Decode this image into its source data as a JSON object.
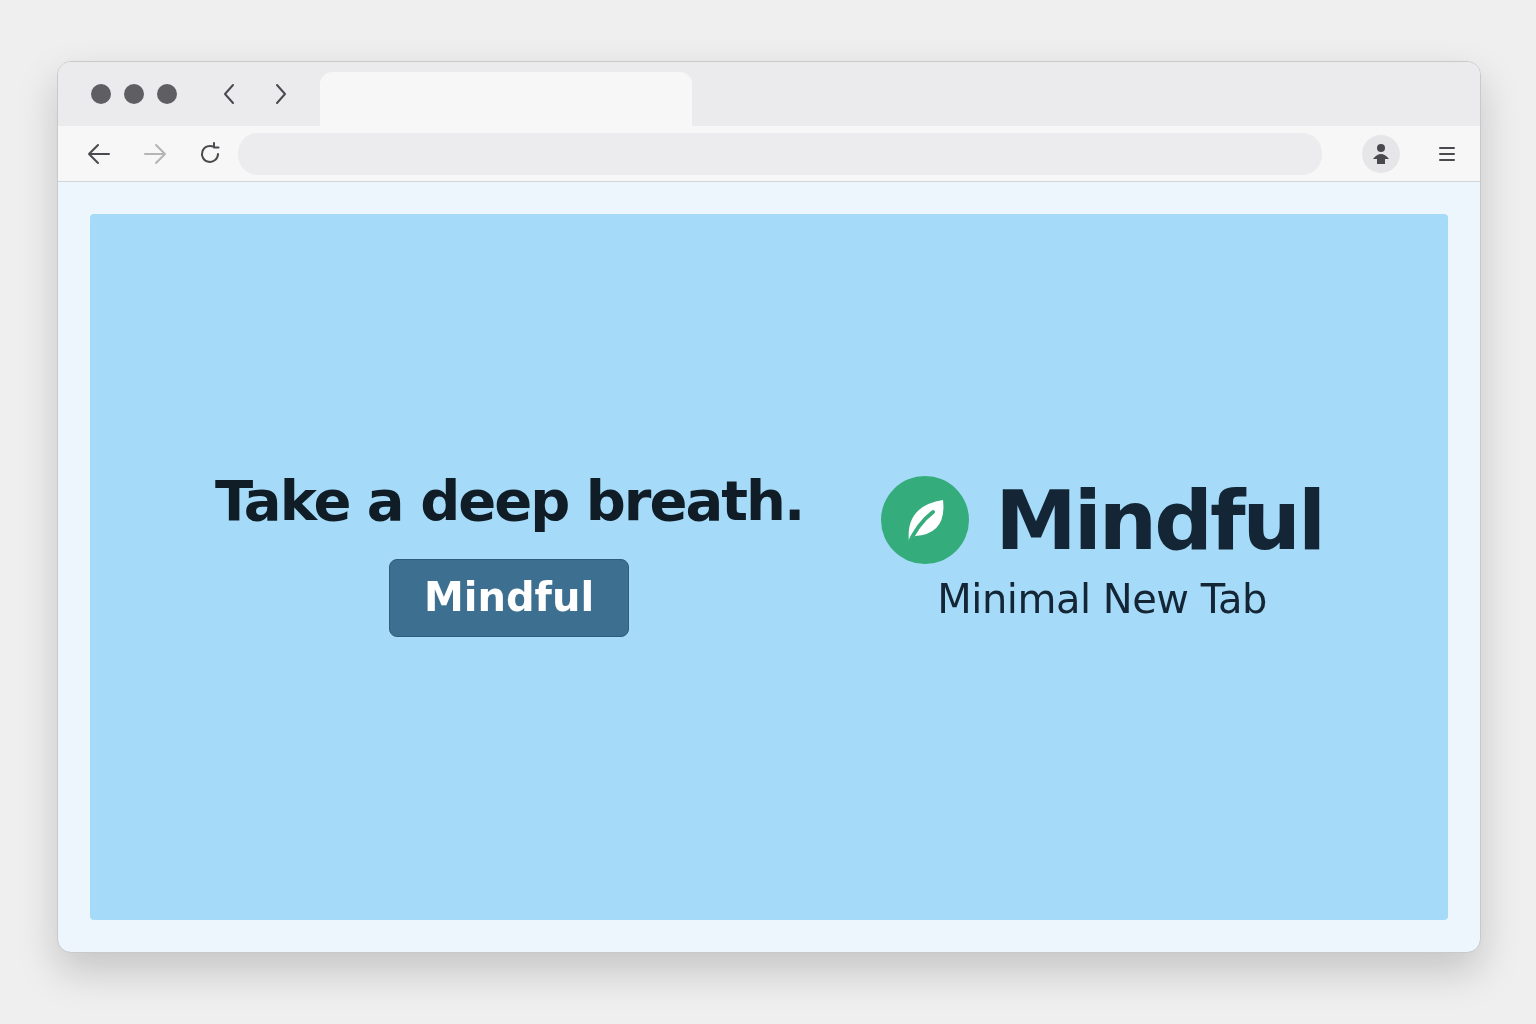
{
  "toolbar": {
    "back": {
      "disabled": false
    },
    "forward": {
      "disabled": true
    }
  },
  "page": {
    "headline": "Take a deep breath.",
    "button": "Mindful",
    "brand": "Mindful",
    "tagline": "Minimal New Tab"
  }
}
